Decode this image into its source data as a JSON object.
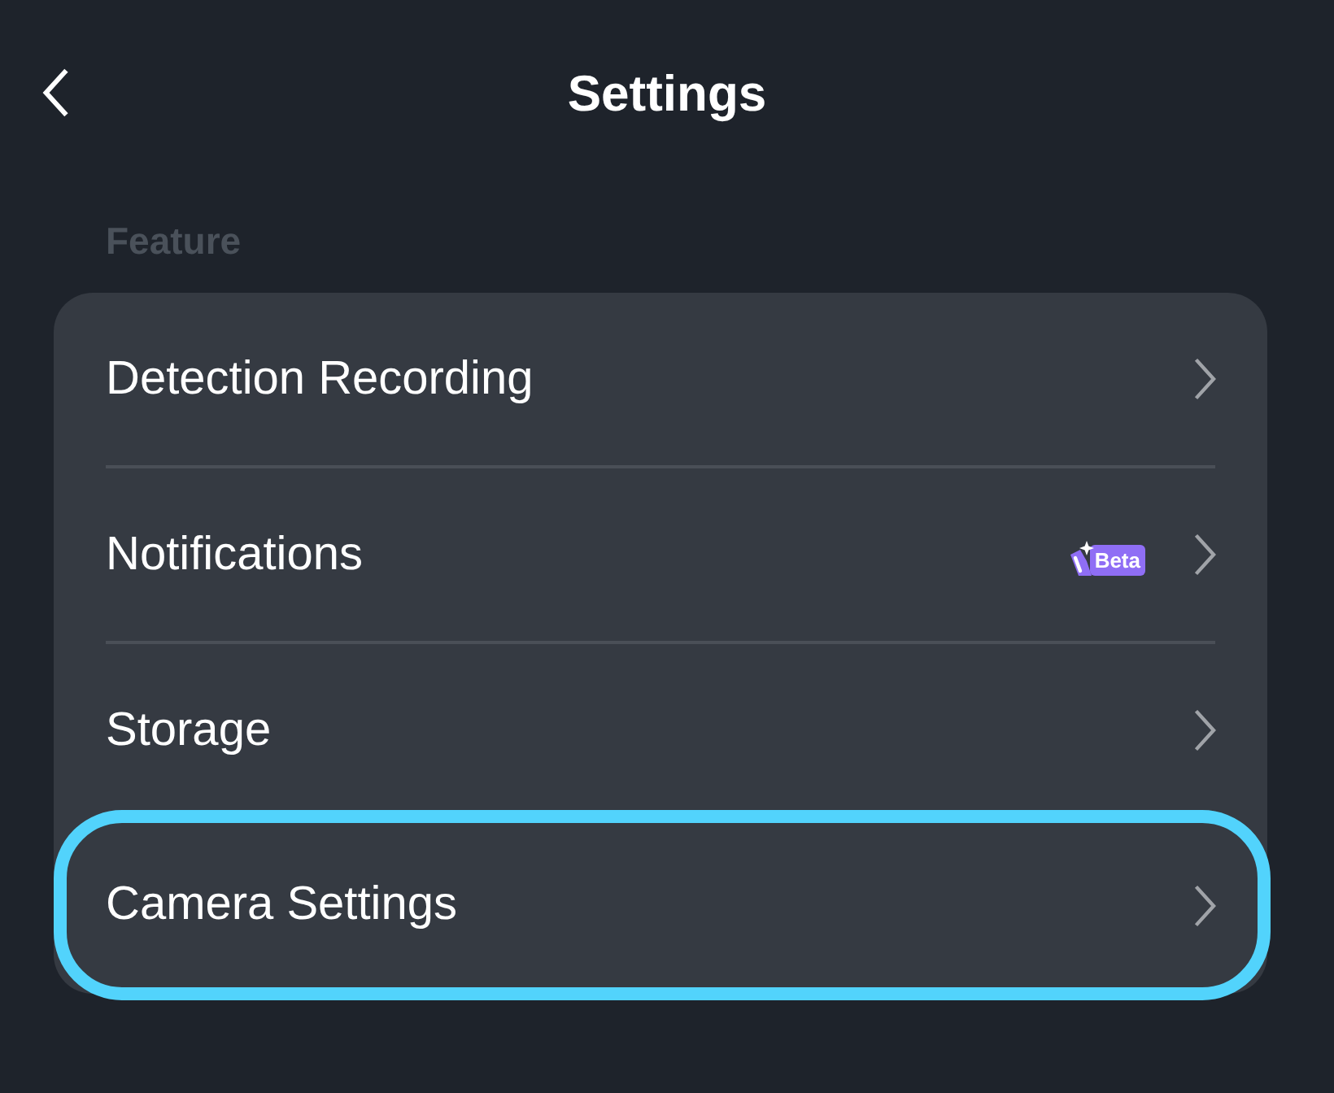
{
  "header": {
    "title": "Settings"
  },
  "sections": [
    {
      "label": "Feature",
      "items": [
        {
          "label": "Detection Recording",
          "selected": false
        },
        {
          "label": "Notifications",
          "badge": "Beta",
          "selected": false
        },
        {
          "label": "Storage",
          "selected": false
        },
        {
          "label": "Camera Settings",
          "selected": true
        }
      ]
    }
  ]
}
